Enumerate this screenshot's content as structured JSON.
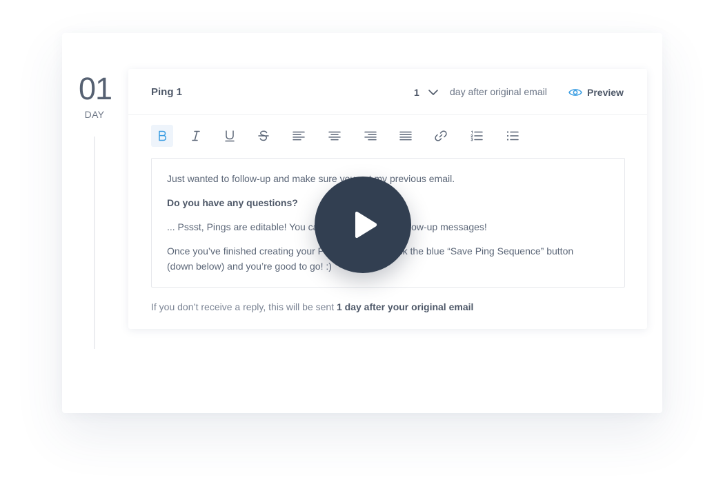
{
  "day": {
    "number": "01",
    "label": "DAY"
  },
  "ping": {
    "title": "Ping 1",
    "days_value": "1",
    "after_text": "day after original email",
    "preview_label": "Preview"
  },
  "toolbar": {
    "buttons": [
      {
        "name": "bold",
        "icon": "bold-icon",
        "active": true
      },
      {
        "name": "italic",
        "icon": "italic-icon"
      },
      {
        "name": "underline",
        "icon": "underline-icon"
      },
      {
        "name": "strikethrough",
        "icon": "strikethrough-icon"
      },
      {
        "name": "align-left",
        "icon": "align-left-icon"
      },
      {
        "name": "align-center",
        "icon": "align-center-icon"
      },
      {
        "name": "align-right",
        "icon": "align-right-icon"
      },
      {
        "name": "justify",
        "icon": "justify-icon"
      },
      {
        "name": "link",
        "icon": "link-icon"
      },
      {
        "name": "ordered-list",
        "icon": "ordered-list-icon"
      },
      {
        "name": "bullet-list",
        "icon": "bullet-list-icon"
      }
    ]
  },
  "editor": {
    "line1": "Just wanted to follow-up and make sure you got my previous email.",
    "line2": "Do you have any questions?",
    "line3": "... Pssst, Pings are editable! You can customize these follow-up messages!",
    "line4a": "Once you’ve finished creating your Ping Sequence, click the blue “Save Ping Sequence” button",
    "line4b": "(down below) and you’re good to go! :)"
  },
  "footer": {
    "prefix": "If you don’t receive a reply, this will be sent ",
    "emphasis": "1 day after your original email"
  },
  "colors": {
    "accent": "#3a9de2",
    "play_button": "#323f51",
    "text": "#5b6677"
  }
}
